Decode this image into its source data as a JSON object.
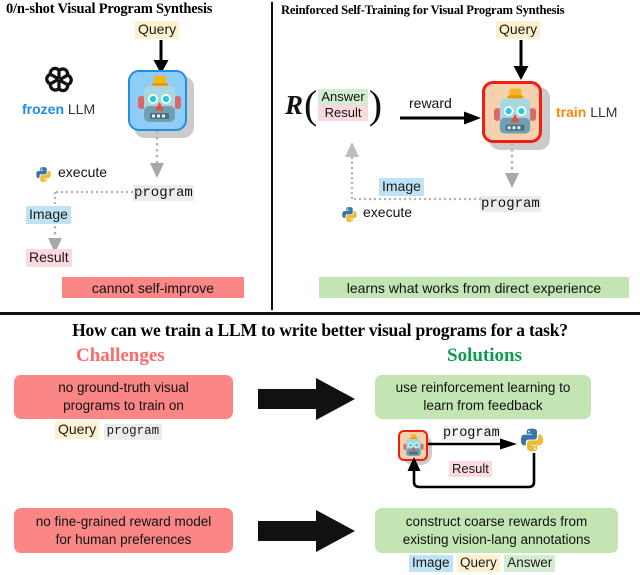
{
  "figure": {
    "panels": {
      "left": {
        "title": "0/n-shot Visual Program Synthesis",
        "query_label": "Query",
        "llm_accent": "frozen",
        "llm_word": "LLM",
        "llm_icon": "openai-logo-icon",
        "robot_icon": "robot-frozen-icon",
        "program_label": "program",
        "execute_label": "execute",
        "python_icon": "python-logo-icon",
        "image_label": "Image",
        "result_label": "Result",
        "conclusion": "cannot self-improve"
      },
      "right": {
        "title": "Reinforced Self-Training for Visual Program Synthesis",
        "query_label": "Query",
        "reward_fn_symbol": "R",
        "reward_numerator": "Answer",
        "reward_denominator": "Result",
        "reward_label": "reward",
        "llm_accent": "train",
        "llm_word": "LLM",
        "robot_icon": "robot-train-icon",
        "program_label": "program",
        "image_label": "Image",
        "execute_label": "execute",
        "python_icon": "python-logo-icon",
        "conclusion": "learns what works from direct experience"
      }
    },
    "bottom": {
      "question": "How can we train a LLM to write better visual programs for a task?",
      "challenges_heading": "Challenges",
      "solutions_heading": "Solutions",
      "rows": [
        {
          "challenge": "no ground-truth visual programs to train on",
          "challenge_line1": "no ground-truth visual",
          "challenge_line2": "programs to train on",
          "challenge_tags": [
            {
              "text": "Query",
              "style": "query"
            },
            {
              "text": "program",
              "style": "program"
            }
          ],
          "solution_line1": "use reinforcement learning to",
          "solution_line2": "learn from feedback",
          "loop": {
            "robot_icon": "robot-train-icon",
            "python_icon": "python-logo-icon",
            "forward_label": "program",
            "return_label": "Result"
          }
        },
        {
          "challenge_line1": "no fine-grained reward model",
          "challenge_line2": "for human preferences",
          "solution_line1": "construct coarse rewards from",
          "solution_line2": "existing vision-lang annotations",
          "solution_tags": [
            {
              "text": "Image",
              "style": "image"
            },
            {
              "text": "Query",
              "style": "query"
            },
            {
              "text": "Answer",
              "style": "answer"
            }
          ]
        }
      ]
    },
    "colors": {
      "query_bg": "#fdf0cf",
      "image_bg": "#bfe2f5",
      "result_bg": "#fbd9de",
      "answer_bg": "#d4ecd1",
      "program_bg": "#ececec",
      "challenge_bg": "#fa8686",
      "solution_bg": "#c3e5b4",
      "challenges_text": "#fa6a6a",
      "solutions_text": "#0f9b4e",
      "frozen_accent": "#1a8cf0",
      "train_accent": "#f58a0b",
      "robot_frozen_border": "#1f8fe0",
      "robot_train_border": "#f01f12"
    }
  }
}
